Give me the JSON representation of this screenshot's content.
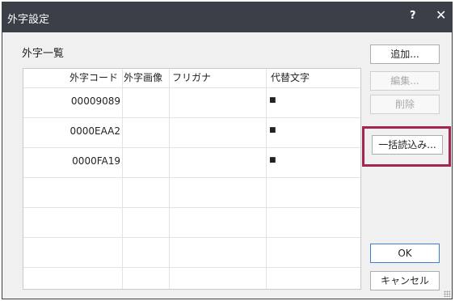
{
  "dialog": {
    "title": "外字設定",
    "help_symbol": "?",
    "close_symbol": "✕",
    "group_label": "外字一覧"
  },
  "table": {
    "columns": [
      "外字コード",
      "外字画像",
      "フリガナ",
      "代替文字"
    ],
    "rows": [
      {
        "code": "00009089",
        "image": "",
        "furigana": "",
        "alt": "■"
      },
      {
        "code": "0000EAA2",
        "image": "",
        "furigana": "",
        "alt": "■"
      },
      {
        "code": "0000FA19",
        "image": "",
        "furigana": "",
        "alt": "■"
      }
    ]
  },
  "buttons": {
    "add": "追加...",
    "edit": "編集...",
    "delete": "削除",
    "bulk_import": "一括読込み...",
    "ok": "OK",
    "cancel": "キャンセル"
  },
  "colors": {
    "titlebar": "#3a3f48",
    "highlight": "#a4254d"
  }
}
